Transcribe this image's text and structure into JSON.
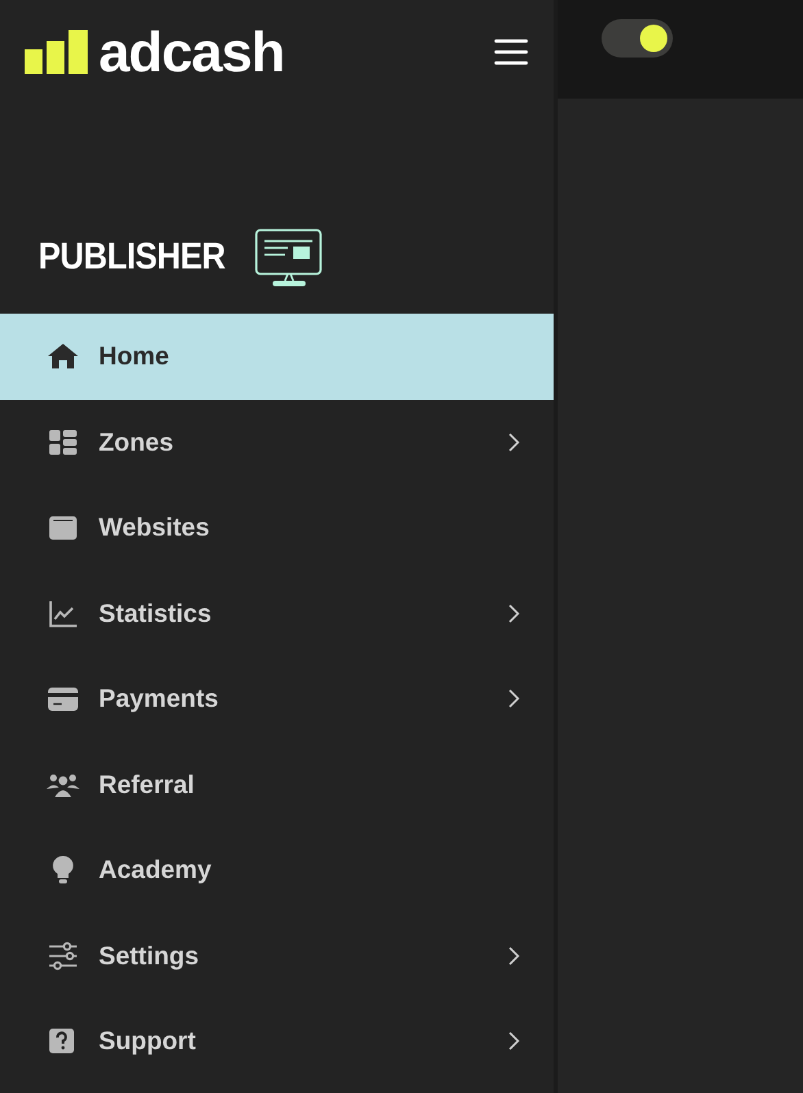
{
  "brand": {
    "name": "adcash"
  },
  "role": {
    "label": "PUBLISHER"
  },
  "theme_toggle": {
    "on": true
  },
  "sidebar": {
    "items": [
      {
        "label": "Home",
        "selected": true,
        "submenu": false
      },
      {
        "label": "Zones",
        "selected": false,
        "submenu": true
      },
      {
        "label": "Websites",
        "selected": false,
        "submenu": false
      },
      {
        "label": "Statistics",
        "selected": false,
        "submenu": true
      },
      {
        "label": "Payments",
        "selected": false,
        "submenu": true
      },
      {
        "label": "Referral",
        "selected": false,
        "submenu": false
      },
      {
        "label": "Academy",
        "selected": false,
        "submenu": false
      },
      {
        "label": "Settings",
        "selected": false,
        "submenu": true
      },
      {
        "label": "Support",
        "selected": false,
        "submenu": true
      }
    ]
  }
}
